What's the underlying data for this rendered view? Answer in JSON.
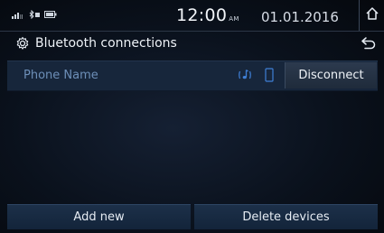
{
  "status_bar": {
    "icons": [
      "signal-icon",
      "bluetooth-audio-icon",
      "battery-icon"
    ],
    "time": "12:00",
    "ampm": "AM",
    "date": "01.01.2016",
    "home_icon": "home-icon"
  },
  "header": {
    "settings_icon": "gear-icon",
    "title": "Bluetooth connections",
    "back_icon": "back-arrow-icon"
  },
  "device_list": [
    {
      "name": "Phone Name",
      "icons": [
        "audio-streaming-icon",
        "phone-icon"
      ],
      "action_label": "Disconnect"
    }
  ],
  "bottom_bar": {
    "add_label": "Add new",
    "delete_label": "Delete devices"
  },
  "colors": {
    "accent": "#6d8fb8",
    "row_bg": "#17263b",
    "button_bg": "#1c3049"
  }
}
